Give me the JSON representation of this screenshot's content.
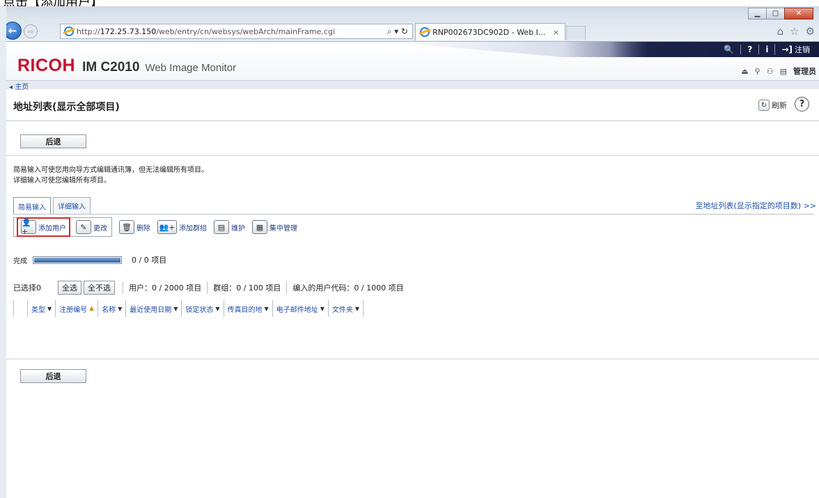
{
  "caption_fragment": "点击【添加用户】",
  "browser": {
    "url_prefix": "http://",
    "url_host": "172.25.73.150",
    "url_path": "/web/entry/cn/websys/webArch/mainFrame.cgi",
    "addr_tools": "⌕ ▾ ↻",
    "tab_title": "RNP002673DC902D - Web I...",
    "tab_close": "×",
    "caption_min": "▁",
    "caption_max": "□",
    "caption_close": "✕",
    "home_icon": "⌂",
    "star_icon": "☆",
    "gear_icon": "⚙",
    "back_glyph": "←",
    "forward_glyph": "⇨"
  },
  "header": {
    "brand": "RICOH",
    "model": "IM C2010",
    "product": "Web Image Monitor",
    "links": [
      {
        "glyph": "🔍",
        "label": ""
      },
      {
        "glyph": "?",
        "label": ""
      },
      {
        "glyph": "i",
        "label": ""
      },
      {
        "glyph": "→]",
        "label": "注销"
      }
    ],
    "status_icons": [
      "⏏",
      "⚲",
      "⚇",
      "▤"
    ],
    "user": "管理员"
  },
  "nav": {
    "home": "◂ 主页"
  },
  "page": {
    "title": "地址列表(显示全部项目)",
    "refresh_label": "刷新",
    "refresh_icon": "↻",
    "help_icon": "?",
    "back_label": "后退",
    "desc_line1": "简易输入可使您用向导方式编辑通讯簿，但无法编辑所有项目。",
    "desc_line2": "详细输入可使您编辑所有项目。",
    "far_link": "至地址列表(显示指定的项目数) >>"
  },
  "tabs": [
    {
      "label": "简易输入",
      "active": true
    },
    {
      "label": "详细输入",
      "active": false
    }
  ],
  "toolbar": {
    "add_user": {
      "label": "添加用户",
      "icon": "👤+"
    },
    "change": {
      "label": "更改",
      "icon": "✎"
    },
    "delete": {
      "label": "删除",
      "icon": "🗑"
    },
    "add_group": {
      "label": "添加群组",
      "icon": "👥+"
    },
    "maintenance": {
      "label": "维护",
      "icon": "▤"
    },
    "central": {
      "label": "集中管理",
      "icon": "▦"
    }
  },
  "progress": {
    "label": "完成",
    "fraction": 1.0,
    "text": "0 / 0 项目"
  },
  "selection": {
    "selected": "已选择0",
    "select_all": "全选",
    "deselect_all": "全不选",
    "users": "用户：0 / 2000 项目",
    "groups": "群组：0 / 100 项目",
    "user_codes": "编入的用户代码：0 / 1000 项目"
  },
  "columns": [
    {
      "label": "类型",
      "sort": "▼"
    },
    {
      "label": "注册编号",
      "sort": "▲"
    },
    {
      "label": "名称",
      "sort": "▼"
    },
    {
      "label": "最近使用日期",
      "sort": "▼"
    },
    {
      "label": "锁定状态",
      "sort": "▼"
    },
    {
      "label": "传真目的地",
      "sort": "▼"
    },
    {
      "label": "电子邮件地址",
      "sort": "▼"
    },
    {
      "label": "文件夹",
      "sort": "▼"
    }
  ],
  "colors": {
    "brand_red": "#c8102e",
    "link_blue": "#1f4ea6",
    "highlight_red": "#d12a2a",
    "header_navy": "#1a2349"
  }
}
